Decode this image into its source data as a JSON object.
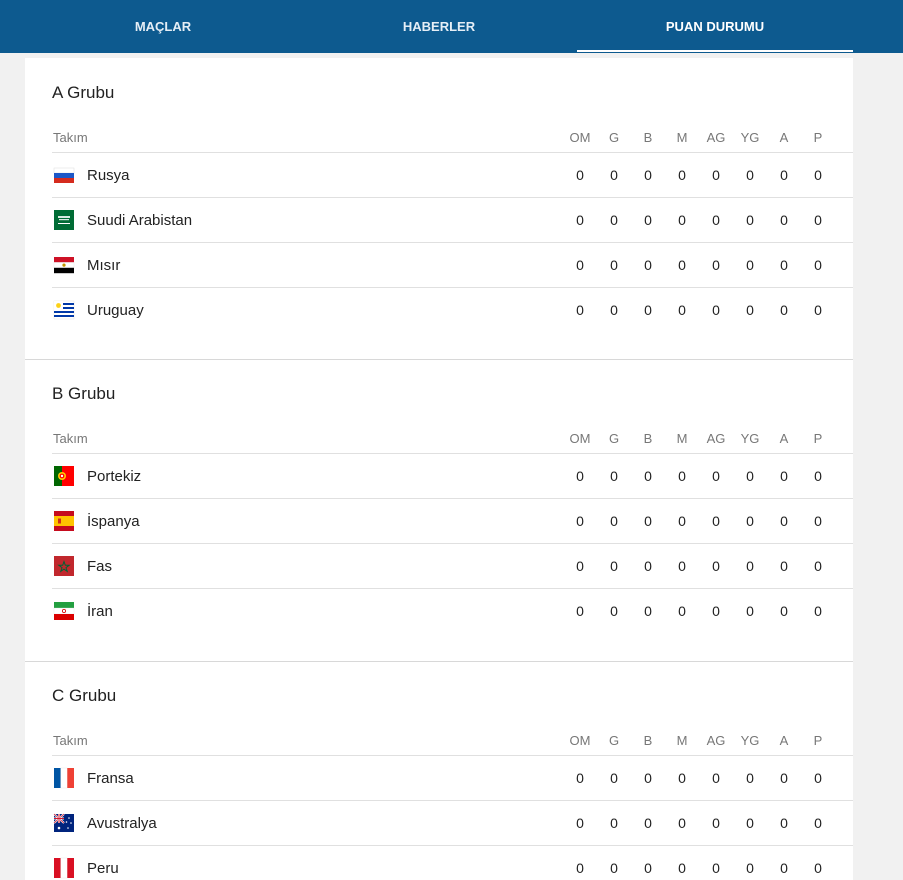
{
  "nav": {
    "tabs": [
      {
        "label": "MAÇLAR",
        "active": false
      },
      {
        "label": "HABERLER",
        "active": false
      },
      {
        "label": "PUAN DURUMU",
        "active": true
      }
    ]
  },
  "columns": {
    "team": "Takım",
    "stats": [
      "OM",
      "G",
      "B",
      "M",
      "AG",
      "YG",
      "A",
      "P"
    ]
  },
  "groups": [
    {
      "title": "A Grubu",
      "teams": [
        {
          "name": "Rusya",
          "flag_icon": "russia-flag-icon",
          "stats": [
            "0",
            "0",
            "0",
            "0",
            "0",
            "0",
            "0",
            "0"
          ]
        },
        {
          "name": "Suudi Arabistan",
          "flag_icon": "saudi-arabia-flag-icon",
          "stats": [
            "0",
            "0",
            "0",
            "0",
            "0",
            "0",
            "0",
            "0"
          ]
        },
        {
          "name": "Mısır",
          "flag_icon": "egypt-flag-icon",
          "stats": [
            "0",
            "0",
            "0",
            "0",
            "0",
            "0",
            "0",
            "0"
          ]
        },
        {
          "name": "Uruguay",
          "flag_icon": "uruguay-flag-icon",
          "stats": [
            "0",
            "0",
            "0",
            "0",
            "0",
            "0",
            "0",
            "0"
          ]
        }
      ]
    },
    {
      "title": "B Grubu",
      "teams": [
        {
          "name": "Portekiz",
          "flag_icon": "portugal-flag-icon",
          "stats": [
            "0",
            "0",
            "0",
            "0",
            "0",
            "0",
            "0",
            "0"
          ]
        },
        {
          "name": "İspanya",
          "flag_icon": "spain-flag-icon",
          "stats": [
            "0",
            "0",
            "0",
            "0",
            "0",
            "0",
            "0",
            "0"
          ]
        },
        {
          "name": "Fas",
          "flag_icon": "morocco-flag-icon",
          "stats": [
            "0",
            "0",
            "0",
            "0",
            "0",
            "0",
            "0",
            "0"
          ]
        },
        {
          "name": "İran",
          "flag_icon": "iran-flag-icon",
          "stats": [
            "0",
            "0",
            "0",
            "0",
            "0",
            "0",
            "0",
            "0"
          ]
        }
      ]
    },
    {
      "title": "C Grubu",
      "teams": [
        {
          "name": "Fransa",
          "flag_icon": "france-flag-icon",
          "stats": [
            "0",
            "0",
            "0",
            "0",
            "0",
            "0",
            "0",
            "0"
          ]
        },
        {
          "name": "Avustralya",
          "flag_icon": "australia-flag-icon",
          "stats": [
            "0",
            "0",
            "0",
            "0",
            "0",
            "0",
            "0",
            "0"
          ]
        },
        {
          "name": "Peru",
          "flag_icon": "peru-flag-icon",
          "stats": [
            "0",
            "0",
            "0",
            "0",
            "0",
            "0",
            "0",
            "0"
          ]
        }
      ]
    }
  ],
  "colors": {
    "nav_background": "#0d5a8f",
    "page_background": "#f1f1f1",
    "panel_background": "#ffffff"
  }
}
